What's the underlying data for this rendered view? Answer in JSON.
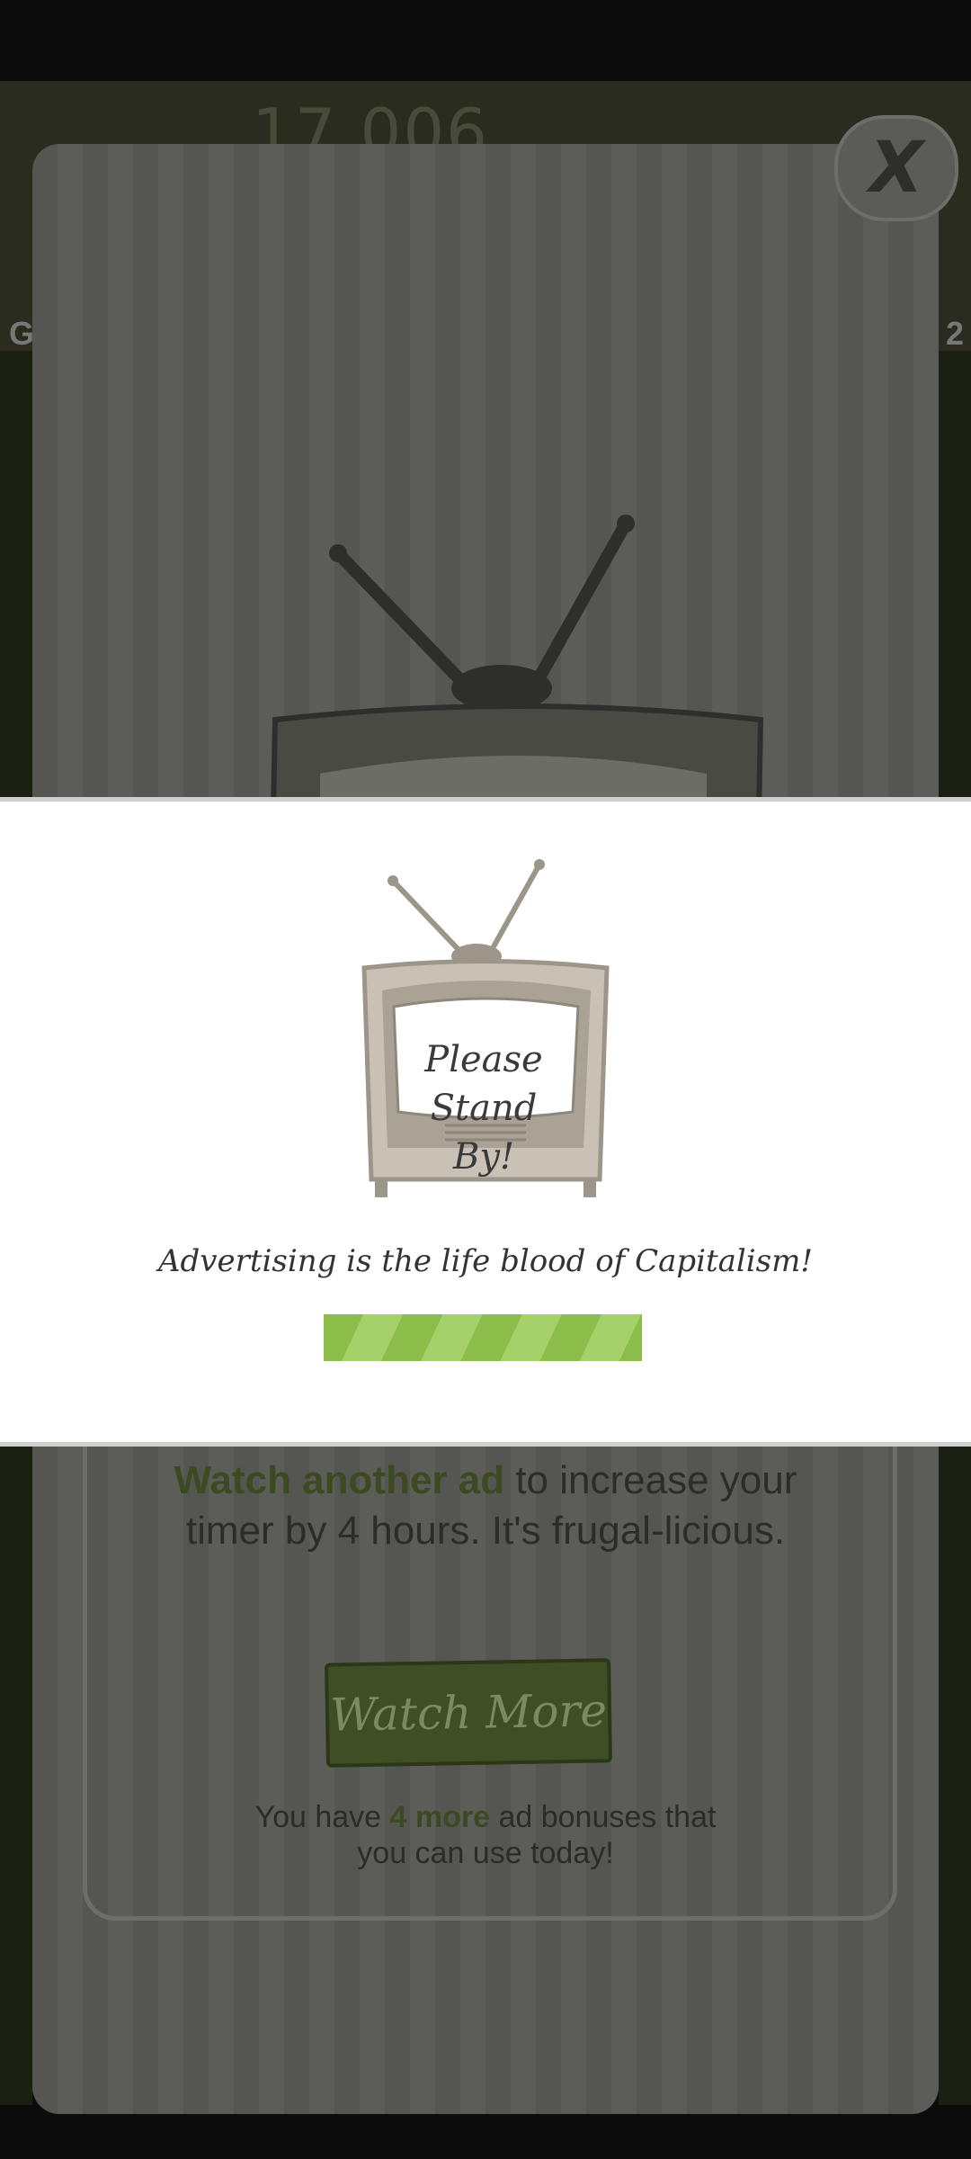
{
  "background": {
    "score": "17,006",
    "edge_left": "G",
    "edge_right": "2"
  },
  "modal": {
    "close_label": "X",
    "promo_highlight": "Watch another ad",
    "promo_rest": " to increase your timer by 4 hours. It's frugal-licious.",
    "watch_more_label": "Watch More",
    "bonus_prefix": "You have ",
    "bonus_count": "4 more",
    "bonus_suffix": " ad bonuses that you can use today!"
  },
  "loading": {
    "standby_line1": "Please",
    "standby_line2": "Stand By!",
    "tagline": "Advertising is the life blood of Capitalism!",
    "progress_percent": 100
  },
  "colors": {
    "progress_green": "#8cbd4a",
    "highlight_green": "#3c4a22"
  }
}
